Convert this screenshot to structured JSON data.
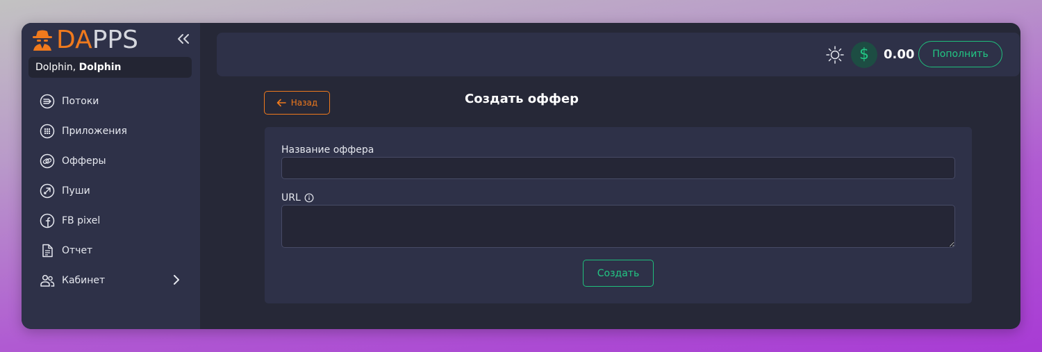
{
  "brand": {
    "logo_part1": "DA",
    "logo_part2": "PPS",
    "accent_color": "#f07a1d",
    "logo_icon": "spy-agent-icon"
  },
  "sidebar": {
    "collapse_icon": "double-chevron-left-icon",
    "user": {
      "first": "Dolphin,",
      "second": "Dolphin"
    },
    "items": [
      {
        "label": "Потоки",
        "icon": "flow-arrow-icon"
      },
      {
        "label": "Приложения",
        "icon": "apps-grid-icon"
      },
      {
        "label": "Офферы",
        "icon": "link-icon"
      },
      {
        "label": "Пуши",
        "icon": "push-rocket-icon"
      },
      {
        "label": "FB pixel",
        "icon": "facebook-icon"
      },
      {
        "label": "Отчет",
        "icon": "report-document-icon"
      },
      {
        "label": "Кабинет",
        "icon": "users-icon",
        "has_submenu": true
      }
    ]
  },
  "topbar": {
    "theme_icon": "sun-icon",
    "currency_symbol": "$",
    "balance": "0.00",
    "topup_label": "Пополнить",
    "success_color": "#22c784"
  },
  "page": {
    "back_label": "Назад",
    "title": "Создать оффер"
  },
  "form": {
    "name_label": "Название оффера",
    "name_value": "",
    "url_label": "URL",
    "url_value": "",
    "submit_label": "Создать"
  }
}
